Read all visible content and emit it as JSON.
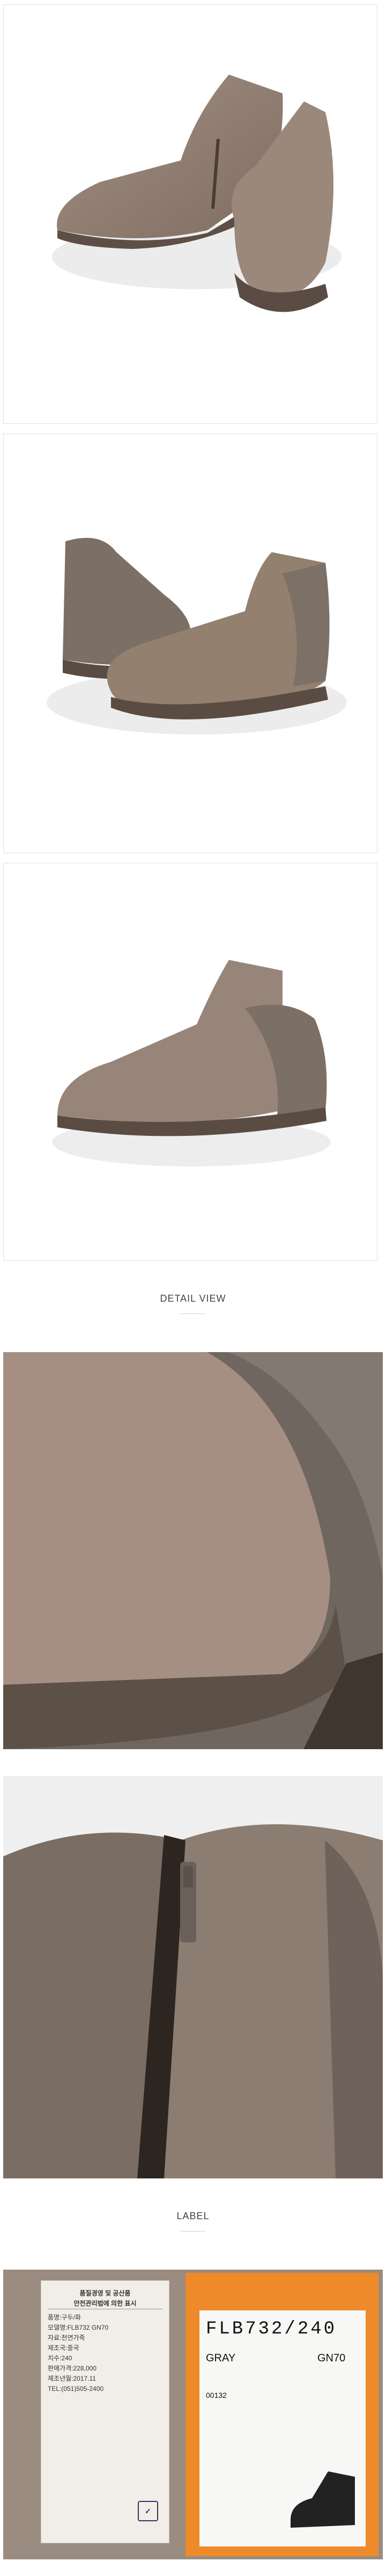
{
  "sections": {
    "detail_heading": "DETAIL VIEW",
    "label_heading": "LABEL"
  },
  "label_card": {
    "lines": [
      "품질경영 및 공산품",
      "안전관리법에 의한 표시",
      "품명:구두/화",
      "모델명:FLB732 GN70",
      "자료:천연가죽",
      "제조국:중국",
      "치수:240",
      "판매가격:228,000",
      "제조년월:2017.11",
      "TEL:(051)505-2400"
    ]
  },
  "orange_tag": {
    "code": "FLB732/240",
    "color": "GRAY",
    "variant": "GN70",
    "number": "00132"
  },
  "colors": {
    "suede": "#8f7c70",
    "leather": "#7b6f66",
    "sole": "#5a4c43",
    "tag_orange": "#ee8a2a"
  }
}
